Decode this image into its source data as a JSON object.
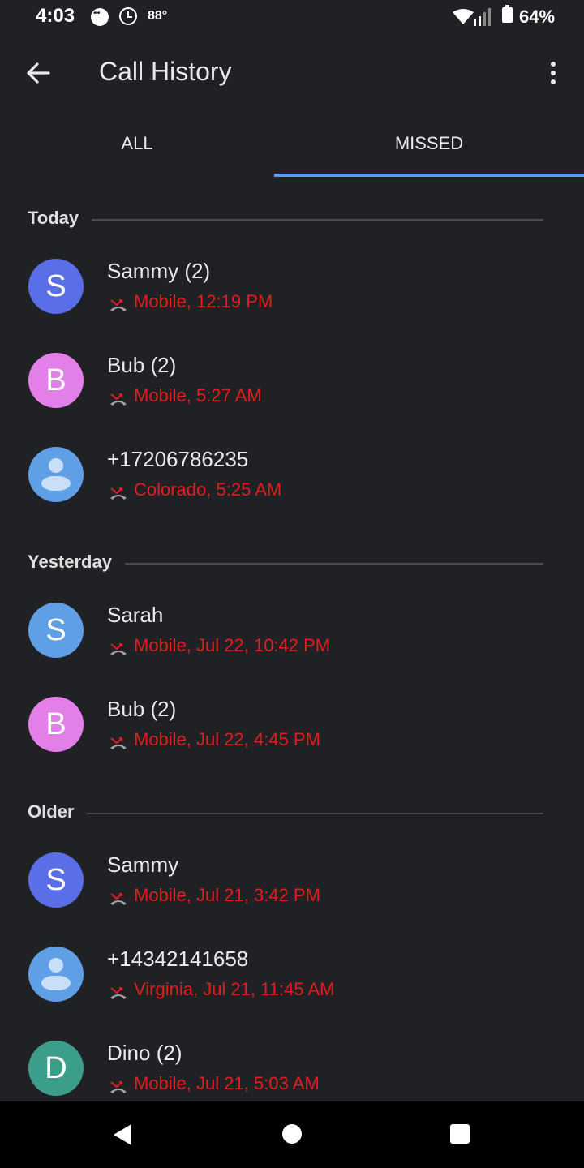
{
  "status_bar": {
    "time": "4:03",
    "temperature": "88°",
    "battery": "64%"
  },
  "app_bar": {
    "title": "Call History"
  },
  "tabs": [
    {
      "label": "ALL"
    },
    {
      "label": "MISSED"
    }
  ],
  "sections": [
    {
      "label": "Today"
    },
    {
      "label": "Yesterday"
    },
    {
      "label": "Older"
    }
  ],
  "calls": [
    {
      "avatar": "S",
      "avatar_color": "#5a6ee8",
      "name": "Sammy (2)",
      "detail": "Mobile, 12:19 PM"
    },
    {
      "avatar": "B",
      "avatar_color": "#e37fe8",
      "name": "Bub (2)",
      "detail": "Mobile, 5:27 AM"
    },
    {
      "avatar": "",
      "avatar_color": "#5e9fe6",
      "name": "+17206786235",
      "detail": "Colorado, 5:25 AM"
    },
    {
      "avatar": "S",
      "avatar_color": "#5e9fe6",
      "name": "Sarah",
      "detail": "Mobile, Jul 22, 10:42 PM"
    },
    {
      "avatar": "B",
      "avatar_color": "#e37fe8",
      "name": "Bub (2)",
      "detail": "Mobile, Jul 22, 4:45 PM"
    },
    {
      "avatar": "S",
      "avatar_color": "#5a6ee8",
      "name": "Sammy",
      "detail": "Mobile, Jul 21, 3:42 PM"
    },
    {
      "avatar": "",
      "avatar_color": "#5e9fe6",
      "name": "+14342141658",
      "detail": "Virginia, Jul 21, 11:45 AM"
    },
    {
      "avatar": "D",
      "avatar_color": "#3a9e8a",
      "name": "Dino (2)",
      "detail": "Mobile, Jul 21, 5:03 AM"
    }
  ],
  "colors": {
    "accent": "#5b9cec",
    "missed": "#e11d1d",
    "background": "#202124"
  }
}
